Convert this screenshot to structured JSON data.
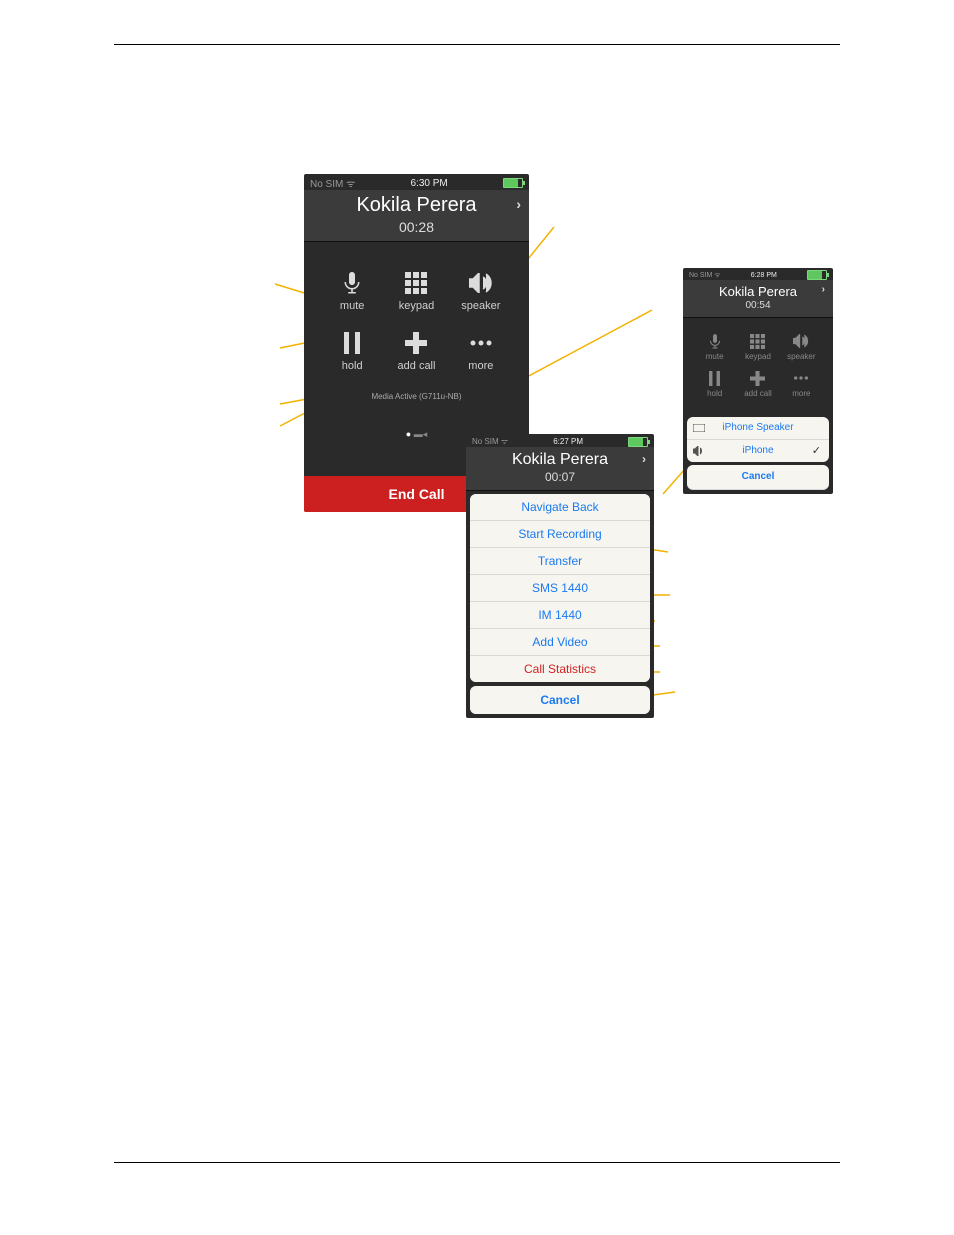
{
  "doc": {
    "top_rule": true,
    "bottom_rule": true
  },
  "main_phone": {
    "status": {
      "left": "No SIM ᯤ",
      "center": "6:30 PM"
    },
    "contact": "Kokila Perera",
    "duration": "00:28",
    "btn_mute": "mute",
    "btn_keypad": "keypad",
    "btn_speaker": "speaker",
    "btn_hold": "hold",
    "btn_addcall": "add call",
    "btn_more": "more",
    "media_text": "Media Active (G711u-NB)",
    "end_call": "End Call"
  },
  "more_phone": {
    "status": {
      "left": "No SIM ᯤ",
      "center": "6:27 PM"
    },
    "contact": "Kokila Perera",
    "duration": "00:07",
    "options": {
      "navigate_back": "Navigate Back",
      "start_recording": "Start Recording",
      "transfer": "Transfer",
      "sms": "SMS 1440",
      "im": "IM 1440",
      "add_video": "Add Video",
      "call_statistics": "Call Statistics"
    },
    "cancel": "Cancel"
  },
  "speaker_phone": {
    "status": {
      "left": "No SIM ᯤ",
      "center": "6:28 PM"
    },
    "contact": "Kokila Perera",
    "duration": "00:54",
    "btn_mute": "mute",
    "btn_keypad": "keypad",
    "btn_speaker": "speaker",
    "btn_hold": "hold",
    "btn_addcall": "add call",
    "btn_more": "more",
    "options": {
      "iphone_speaker": "iPhone Speaker",
      "iphone": "iPhone"
    },
    "cancel": "Cancel"
  }
}
